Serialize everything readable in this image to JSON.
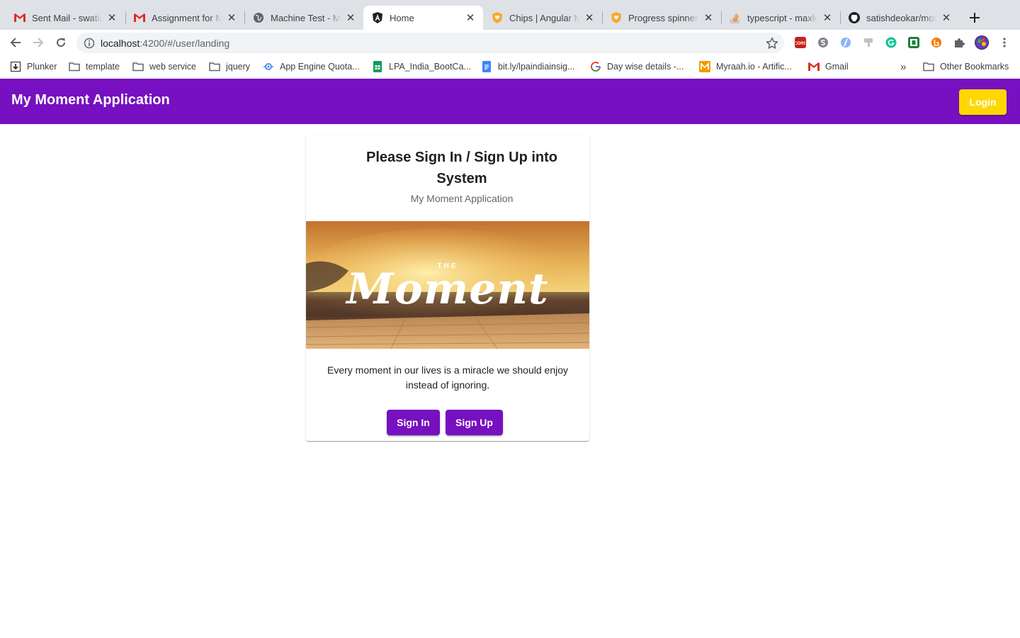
{
  "browser": {
    "tabs": [
      {
        "title": "Sent Mail - swatid",
        "favicon": "gmail-icon",
        "active": false
      },
      {
        "title": "Assignment for Me",
        "favicon": "gmail-icon",
        "active": false
      },
      {
        "title": "Machine Test - ME",
        "favicon": "globe-icon",
        "active": false
      },
      {
        "title": "Home",
        "favicon": "angular-icon",
        "active": true
      },
      {
        "title": "Chips | Angular Ma",
        "favicon": "angular-material-icon",
        "active": false
      },
      {
        "title": "Progress spinner |",
        "favicon": "angular-material-icon",
        "active": false
      },
      {
        "title": "typescript - maxle",
        "favicon": "stackoverflow-icon",
        "active": false
      },
      {
        "title": "satishdeokar/mom",
        "favicon": "github-icon",
        "active": false
      }
    ],
    "url_host": "localhost",
    "url_path": ":4200/#/user/landing",
    "bookmarks": [
      {
        "label": "Plunker",
        "icon": "plunker-icon"
      },
      {
        "label": "template",
        "icon": "folder-icon"
      },
      {
        "label": "web service",
        "icon": "folder-icon"
      },
      {
        "label": "jquery",
        "icon": "folder-icon"
      },
      {
        "label": "App Engine Quota...",
        "icon": "app-engine-icon"
      },
      {
        "label": "LPA_India_BootCa...",
        "icon": "sheets-icon"
      },
      {
        "label": "bit.ly/lpaindiainsig...",
        "icon": "docs-icon"
      },
      {
        "label": "Day wise details -...",
        "icon": "google-icon"
      },
      {
        "label": "Myraah.io - Artific...",
        "icon": "myraah-icon"
      },
      {
        "label": "Gmail",
        "icon": "gmail-icon"
      }
    ],
    "other_bookmarks": "Other Bookmarks"
  },
  "app": {
    "title": "My Moment Application",
    "login_label": "Login",
    "accent": "#7610c0",
    "login_color": "#ffd700"
  },
  "card": {
    "title": "Please Sign In / Sign Up into System",
    "subtitle": "My Moment Application",
    "image_text_small": "THE",
    "image_text_big": "Moment",
    "description": "Every moment in our lives is a miracle we should enjoy instead of ignoring.",
    "sign_in_label": "Sign In",
    "sign_up_label": "Sign Up"
  }
}
